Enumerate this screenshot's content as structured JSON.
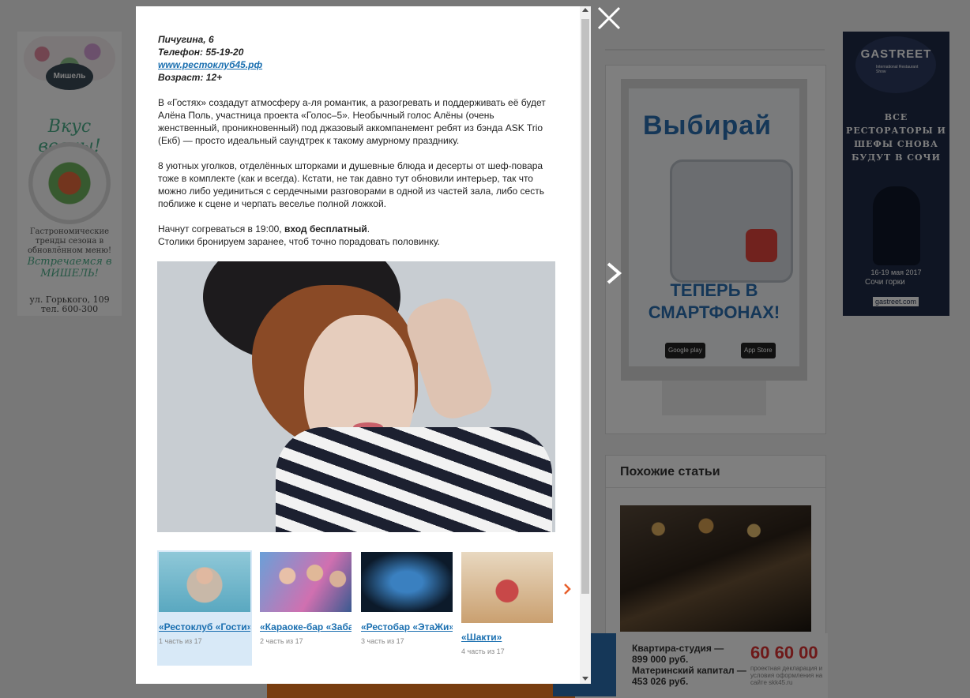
{
  "colors": {
    "accent": "#1a6fb0",
    "arrow": "#e8602c",
    "overlay": "rgba(0,0,0,0.5)"
  },
  "modal": {
    "info": {
      "address": "Пичугина, 6",
      "phone": "Телефон: 55-19-20",
      "website": "www.рестоклуб45.рф",
      "age": "Возраст: 12+"
    },
    "para1": "В «Гостях» создадут атмосферу а-ля романтик, а разогревать и поддерживать её будет Алёна Поль, участница проекта «Голос–5». Необычный голос Алёны (очень женственный, проникновенный) под джазовый аккомпанемент ребят из бэнда ASK Trio (Екб) — просто идеальный саундтрек к такому амурному празднику.",
    "para2": "8 уютных уголков, отделённых шторками и душевные блюда и десерты от шеф-повара тоже в комплекте (как и всегда). Кстати, не так давно тут обновили интерьер, так что можно либо уединиться с сердечными разговорами в одной из частей зала, либо сесть поближе к сцене и черпать веселье полной ложкой.",
    "para3_start": "Начнут согреваться в 19:00, ",
    "para3_bold": "вход бесплатный",
    "para3_end": ".",
    "para3_line2": "Столики бронируем заранее, чтоб точно порадовать половинку.",
    "thumbs": [
      {
        "caption": "«Рестоклуб «Гости»",
        "part": "1 часть из 17"
      },
      {
        "caption": "«Караоке-бар «Забава»",
        "part": "2 часть из 17"
      },
      {
        "caption": "«Рестобар «ЭтаЖи»",
        "part": "3 часть из 17"
      },
      {
        "caption": "«Шакти»",
        "part": "4 часть из 17"
      }
    ],
    "thumbs_next_icon": "chevron-right-icon",
    "close_icon": "close-icon",
    "next_icon": "chevron-right-icon"
  },
  "background": {
    "left_promo": {
      "brand": "Мишель",
      "script": "Вкус весны!",
      "small": "Гастрономические тренды сезона в обновлённом меню!",
      "meet": "Встречаемся в МИШЕЛЬ!",
      "address": "ул. Горького, 109",
      "phone": "тел. 600-300"
    },
    "vybiray_ad": {
      "logo": "Выбирай",
      "tagline": "ТЕПЕРЬ В СМАРТФОНАХ!",
      "google_play": "Google play",
      "app_store": "App Store"
    },
    "gastreet_ad": {
      "name": "GASTREET",
      "sub": "International Restaurant Show",
      "text": "ВСЕ РЕСТОРАТОРЫ И ШЕФЫ СНОВА БУДУТ В СОЧИ",
      "dates": "16-19 мая 2017",
      "city": "Сочи",
      "city_brand": "горки",
      "site": "gastreet.com"
    },
    "similar_title": "Похожие статьи",
    "bottom_banner": {
      "line1": "Квартира-студия —",
      "line2": "899 000 руб.",
      "line3": "Материнский капитал —",
      "line4": "453 026 руб.",
      "phone": "60 60 00",
      "note": "проектная декларация и условия оформления на сайте skk45.ru"
    }
  }
}
